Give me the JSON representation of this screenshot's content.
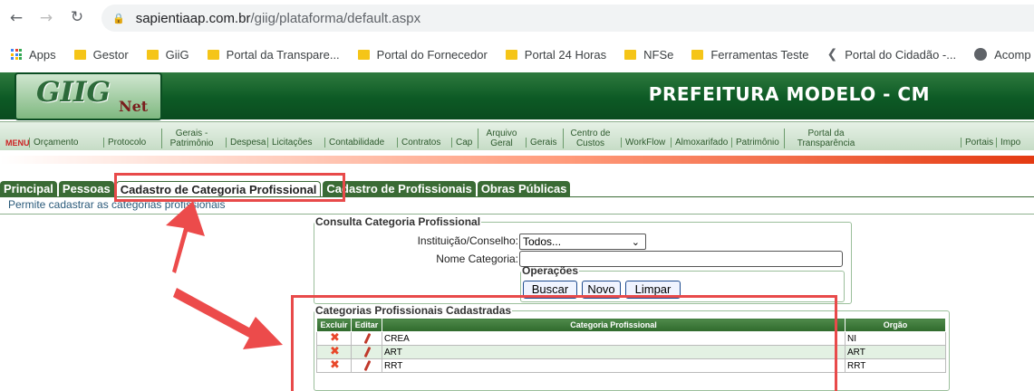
{
  "browser": {
    "url_host": "sapientiaap.com.br",
    "url_path": "/giig/plataforma/default.aspx",
    "bookmarks": [
      "Apps",
      "Gestor",
      "GiiG",
      "Portal da Transpare...",
      "Portal do Fornecedor",
      "Portal 24 Horas",
      "NFSe",
      "Ferramentas Teste",
      "Portal do Cidadão -...",
      "Acomp"
    ]
  },
  "app": {
    "logo_main": "GIIG",
    "logo_sub": "Net",
    "org_title": "PREFEITURA MODELO - CM"
  },
  "menu": {
    "label": "MENU",
    "items": [
      "Orçamento",
      "Protocolo",
      "Gerais - Patrimônio",
      "Despesa",
      "Licitações",
      "Contabilidade",
      "Contratos",
      "Cap",
      "Arquivo Geral",
      "Gerais",
      "Centro de Custos",
      "WorkFlow",
      "Almoxarifado",
      "Patrimônio",
      "Portal da Transparência",
      "Portais",
      "Impo"
    ]
  },
  "tabs": [
    "Principal",
    "Pessoas",
    "Cadastro de Categoria Profissional",
    "Cadastro de Profissionais",
    "Obras Públicas"
  ],
  "active_tab": "Cadastro de Categoria Profissional",
  "description": "Permite cadastrar as categorias profissionais",
  "consulta": {
    "legend": "Consulta Categoria Profissional",
    "instituicao_label": "Instituição/Conselho:",
    "instituicao_value": "Todos...",
    "nome_label": "Nome Categoria:",
    "nome_value": "",
    "operacoes_legend": "Operações",
    "buttons": {
      "buscar": "Buscar",
      "novo": "Novo",
      "limpar": "Limpar"
    }
  },
  "grid": {
    "legend": "Categorias Profissionais Cadastradas",
    "headers": [
      "Excluir",
      "Editar",
      "Categoria Profissional",
      "Orgão"
    ],
    "rows": [
      {
        "categoria": "CREA",
        "orgao": "NI"
      },
      {
        "categoria": "ART",
        "orgao": "ART"
      },
      {
        "categoria": "RRT",
        "orgao": "RRT"
      }
    ]
  },
  "colors": {
    "brand_green": "#2f6a2c",
    "annotation_red": "#e84a4a"
  }
}
